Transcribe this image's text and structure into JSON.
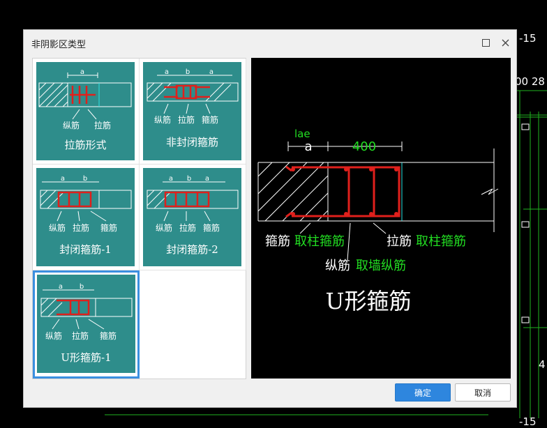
{
  "dialog": {
    "title": "非阴影区类型",
    "ok_label": "确定",
    "cancel_label": "取消"
  },
  "options": [
    {
      "label": "拉筋形式",
      "callouts": [
        "纵筋",
        "拉筋"
      ],
      "dims": [
        "a"
      ],
      "selected": false
    },
    {
      "label": "非封闭箍筋",
      "callouts": [
        "纵筋",
        "拉筋",
        "箍筋"
      ],
      "dims": [
        "a",
        "b",
        "a"
      ],
      "selected": false
    },
    {
      "label": "封闭箍筋-1",
      "callouts": [
        "纵筋",
        "拉筋",
        "箍筋"
      ],
      "dims": [
        "a",
        "b"
      ],
      "selected": false
    },
    {
      "label": "封闭箍筋-2",
      "callouts": [
        "纵筋",
        "拉筋",
        "箍筋"
      ],
      "dims": [
        "a",
        "b",
        "a"
      ],
      "selected": false
    },
    {
      "label": "U形箍筋-1",
      "callouts": [
        "纵筋",
        "拉筋",
        "箍筋"
      ],
      "dims": [
        "a",
        "b"
      ],
      "selected": true
    }
  ],
  "preview": {
    "title": "U形箍筋",
    "dim_lae": "lae",
    "dim_a": "a",
    "dim_400": "400",
    "stirrup_prefix": "箍筋",
    "stirrup_rule": "取柱箍筋",
    "tie_prefix": "拉筋",
    "tie_rule": "取柱箍筋",
    "long_prefix": "纵筋",
    "long_rule": "取墙纵筋"
  },
  "background": {
    "labels": [
      "-15",
      "00 28",
      "4",
      "-15"
    ]
  },
  "colors": {
    "accent": "#2e86de",
    "card": "#2e8d8b",
    "rebar": "#e0201c",
    "highlight_green": "#22dd22"
  }
}
